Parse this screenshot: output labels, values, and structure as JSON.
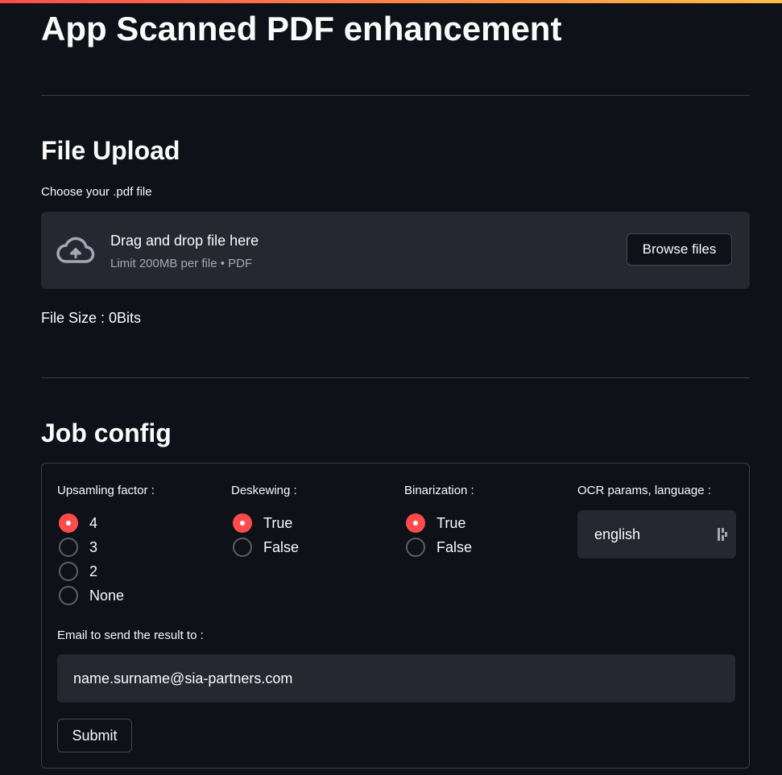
{
  "app": {
    "title": "App Scanned PDF enhancement",
    "accent_gradient": [
      "#ff4b4b",
      "#ffbd45"
    ]
  },
  "upload_section": {
    "heading": "File Upload",
    "field_label": "Choose your .pdf file",
    "dropzone": {
      "icon": "cloud-upload-icon",
      "main_text": "Drag and drop file here",
      "sub_text": "Limit 200MB per file • PDF",
      "browse_label": "Browse files"
    },
    "file_size_text": "File Size : 0Bits"
  },
  "job_config": {
    "heading": "Job config",
    "upsampling": {
      "label": "Upsamling factor :",
      "options": [
        "4",
        "3",
        "2",
        "None"
      ],
      "selected": "4"
    },
    "deskewing": {
      "label": "Deskewing :",
      "options": [
        "True",
        "False"
      ],
      "selected": "True"
    },
    "binarization": {
      "label": "Binarization :",
      "options": [
        "True",
        "False"
      ],
      "selected": "True"
    },
    "ocr": {
      "label": "OCR params, language :",
      "value": "english"
    },
    "email": {
      "label": "Email to send the result to :",
      "value": "name.surname@sia-partners.com"
    },
    "submit_label": "Submit"
  },
  "colors": {
    "background": "#0e1117",
    "surface": "#262730",
    "primary": "#ff4b4b",
    "border": "#3b3e46",
    "muted_text": "#a3a8b8"
  }
}
